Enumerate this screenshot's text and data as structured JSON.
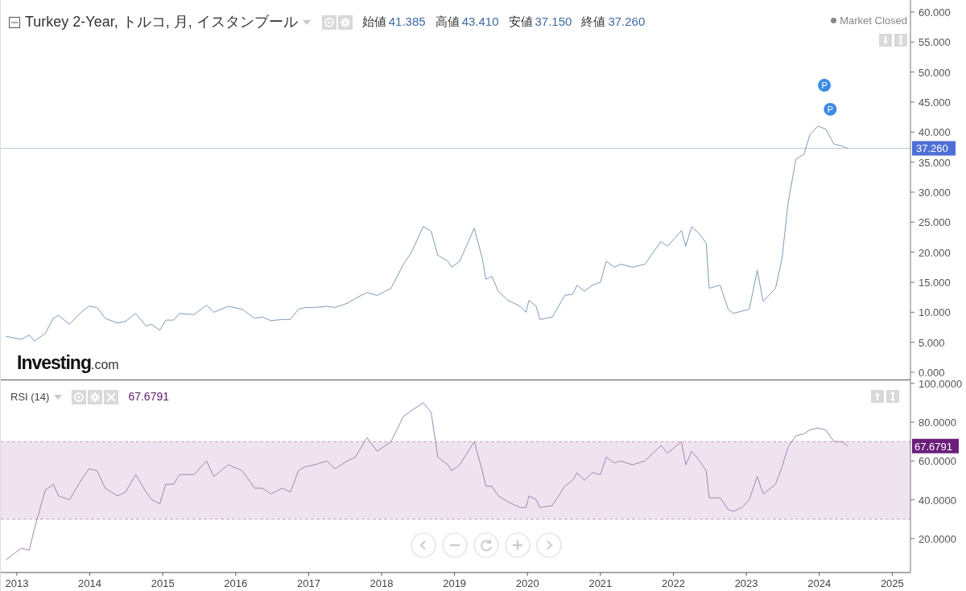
{
  "header": {
    "title": "Turkey 2-Year, トルコ, 月, イスタンブール",
    "ohlc": [
      {
        "label": "始値",
        "value": "41.385"
      },
      {
        "label": "高値",
        "value": "43.410"
      },
      {
        "label": "安値",
        "value": "37.150"
      },
      {
        "label": "終値",
        "value": "37.260"
      }
    ],
    "status": "Market Closed"
  },
  "price_pane": {
    "last_value": "37.260",
    "logo": {
      "name": "Investing",
      "suffix": ".com"
    },
    "chart_data": {
      "type": "line",
      "ylim": [
        -1.2,
        62
      ],
      "xlim": [
        2012.78,
        2025.25
      ],
      "ref_lines": [
        {
          "axis": "y",
          "value": 37.3
        }
      ],
      "yticks": [
        {
          "value": 0,
          "label": "0.000"
        },
        {
          "value": 5,
          "label": "5.000"
        },
        {
          "value": 10,
          "label": "10.000"
        },
        {
          "value": 15,
          "label": "15.000"
        },
        {
          "value": 20,
          "label": "20.000"
        },
        {
          "value": 25,
          "label": "25.000"
        },
        {
          "value": 30,
          "label": "30.000"
        },
        {
          "value": 35,
          "label": "35.000"
        },
        {
          "value": 40,
          "label": "40.000"
        },
        {
          "value": 45,
          "label": "45.000"
        },
        {
          "value": 50,
          "label": "50.000"
        },
        {
          "value": 55,
          "label": "55.000"
        },
        {
          "value": 60,
          "label": "60.000"
        }
      ],
      "x": [
        2012.85,
        2013.06,
        2013.17,
        2013.24,
        2013.39,
        2013.5,
        2013.57,
        2013.72,
        2013.88,
        2013.99,
        2014.1,
        2014.21,
        2014.38,
        2014.49,
        2014.63,
        2014.77,
        2014.85,
        2014.96,
        2015.04,
        2015.15,
        2015.23,
        2015.43,
        2015.6,
        2015.7,
        2015.9,
        2016.09,
        2016.26,
        2016.37,
        2016.48,
        2016.64,
        2016.75,
        2016.86,
        2016.95,
        2017.08,
        2017.25,
        2017.36,
        2017.53,
        2017.64,
        2017.8,
        2017.94,
        2018.13,
        2018.3,
        2018.41,
        2018.57,
        2018.68,
        2018.77,
        2018.91,
        2018.96,
        2019.07,
        2019.27,
        2019.38,
        2019.43,
        2019.51,
        2019.6,
        2019.73,
        2019.9,
        2019.98,
        2020.02,
        2020.12,
        2020.17,
        2020.34,
        2020.51,
        2020.62,
        2020.68,
        2020.78,
        2020.89,
        2021.0,
        2021.08,
        2021.19,
        2021.28,
        2021.44,
        2021.61,
        2021.83,
        2021.92,
        2022.11,
        2022.17,
        2022.25,
        2022.36,
        2022.45,
        2022.49,
        2022.64,
        2022.75,
        2022.82,
        2022.94,
        2023.04,
        2023.15,
        2023.23,
        2023.4,
        2023.49,
        2023.57,
        2023.68,
        2023.79,
        2023.87,
        2023.98,
        2024.09,
        2024.2,
        2024.31,
        2024.39
      ],
      "series": [
        {
          "color": "#7e9ab8",
          "values": [
            6.0,
            5.5,
            6.2,
            5.2,
            6.5,
            9.0,
            9.5,
            8.0,
            10.0,
            11.0,
            10.8,
            9.0,
            8.2,
            8.5,
            9.8,
            7.7,
            8.0,
            7.0,
            8.7,
            8.7,
            9.8,
            9.6,
            11.2,
            10.0,
            11.0,
            10.5,
            9.0,
            9.2,
            8.6,
            8.8,
            8.8,
            10.5,
            10.8,
            10.8,
            11.0,
            10.8,
            11.5,
            12.3,
            13.3,
            12.8,
            14.0,
            18.0,
            20.0,
            24.3,
            23.5,
            19.5,
            18.5,
            17.5,
            18.5,
            24.0,
            19.0,
            15.5,
            16.0,
            13.5,
            12.0,
            11.0,
            10.0,
            12.0,
            11.0,
            8.8,
            9.2,
            12.8,
            13.0,
            14.5,
            13.5,
            14.5,
            15.0,
            18.5,
            17.5,
            18.0,
            17.5,
            18.0,
            21.8,
            21.0,
            23.6,
            21.0,
            24.3,
            23.0,
            21.5,
            14.0,
            14.5,
            10.5,
            9.8,
            10.2,
            10.5,
            17.0,
            11.8,
            14.0,
            19.0,
            28.0,
            35.5,
            36.3,
            39.5,
            41.0,
            40.5,
            38.0,
            37.7,
            37.3
          ]
        }
      ],
      "annotations": [
        {
          "x": 2024.07,
          "y": 47.8,
          "text": "P"
        },
        {
          "x": 2024.15,
          "y": 43.8,
          "text": "P"
        }
      ]
    }
  },
  "rsi_pane": {
    "label": "RSI (14)",
    "value": "67.6791",
    "tag_value": "67.6791",
    "chart_data": {
      "type": "line",
      "ylim": [
        2.5,
        102
      ],
      "xlim": [
        2012.78,
        2025.25
      ],
      "bands": [
        {
          "axis": "y",
          "from": 30,
          "to": 70
        }
      ],
      "ref_lines": [
        {
          "axis": "y",
          "value": 70
        },
        {
          "axis": "y",
          "value": 30
        }
      ],
      "xticks": [
        {
          "value": 2013,
          "label": "2013"
        },
        {
          "value": 2014,
          "label": "2014"
        },
        {
          "value": 2015,
          "label": "2015"
        },
        {
          "value": 2016,
          "label": "2016"
        },
        {
          "value": 2017,
          "label": "2017"
        },
        {
          "value": 2018,
          "label": "2018"
        },
        {
          "value": 2019,
          "label": "2019"
        },
        {
          "value": 2020,
          "label": "2020"
        },
        {
          "value": 2021,
          "label": "2021"
        },
        {
          "value": 2022,
          "label": "2022"
        },
        {
          "value": 2023,
          "label": "2023"
        },
        {
          "value": 2024,
          "label": "2024"
        },
        {
          "value": 2025,
          "label": "2025"
        }
      ],
      "yticks": [
        {
          "value": 20,
          "label": "20.0000"
        },
        {
          "value": 40,
          "label": "40.0000"
        },
        {
          "value": 60,
          "label": "60.0000"
        },
        {
          "value": 80,
          "label": "80.0000"
        },
        {
          "value": 100,
          "label": "100.0000"
        }
      ],
      "x": [
        2012.85,
        2013.06,
        2013.17,
        2013.24,
        2013.39,
        2013.5,
        2013.57,
        2013.72,
        2013.88,
        2013.99,
        2014.1,
        2014.21,
        2014.38,
        2014.49,
        2014.63,
        2014.77,
        2014.85,
        2014.96,
        2015.04,
        2015.15,
        2015.23,
        2015.43,
        2015.6,
        2015.7,
        2015.9,
        2016.09,
        2016.26,
        2016.37,
        2016.48,
        2016.64,
        2016.75,
        2016.86,
        2016.95,
        2017.08,
        2017.25,
        2017.36,
        2017.53,
        2017.64,
        2017.8,
        2017.94,
        2018.13,
        2018.3,
        2018.41,
        2018.57,
        2018.68,
        2018.77,
        2018.91,
        2018.96,
        2019.07,
        2019.27,
        2019.38,
        2019.43,
        2019.51,
        2019.6,
        2019.73,
        2019.9,
        2019.98,
        2020.02,
        2020.12,
        2020.17,
        2020.34,
        2020.51,
        2020.62,
        2020.68,
        2020.78,
        2020.89,
        2021.0,
        2021.08,
        2021.19,
        2021.28,
        2021.44,
        2021.61,
        2021.83,
        2021.92,
        2022.11,
        2022.17,
        2022.25,
        2022.36,
        2022.45,
        2022.49,
        2022.64,
        2022.75,
        2022.82,
        2022.94,
        2023.04,
        2023.15,
        2023.23,
        2023.4,
        2023.49,
        2023.57,
        2023.68,
        2023.79,
        2023.87,
        2023.98,
        2024.09,
        2024.2,
        2024.31,
        2024.39
      ],
      "series": [
        {
          "color": "#a583b0",
          "values": [
            9,
            15,
            14,
            25,
            45,
            48,
            42,
            40,
            50,
            56,
            55,
            46,
            42,
            44,
            53,
            44,
            40,
            38,
            48,
            48,
            53,
            53,
            60,
            52,
            58,
            55,
            46,
            46,
            43,
            46,
            44,
            55,
            57,
            58,
            60,
            56,
            60,
            62,
            72,
            65,
            70,
            83,
            86,
            90,
            85,
            62,
            58,
            55,
            58,
            70,
            55,
            47,
            47,
            42,
            39,
            36,
            36,
            42,
            40,
            36,
            37,
            47,
            50,
            54,
            50,
            54,
            53,
            62,
            59,
            60,
            58,
            60,
            68,
            64,
            70,
            58,
            65,
            60,
            55,
            41,
            41,
            35,
            34,
            36,
            40,
            52,
            43,
            48,
            57,
            67,
            73,
            74,
            76,
            77,
            76,
            70,
            70,
            67.7
          ]
        }
      ]
    }
  }
}
